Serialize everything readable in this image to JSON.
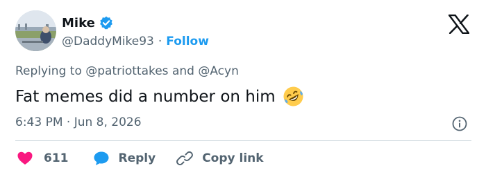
{
  "author": {
    "name": "Mike",
    "handle": "@DaddyMike93",
    "separator": "·",
    "follow_label": "Follow",
    "verified_color": "#1d9bf0"
  },
  "platform_logo": "x-logo-icon",
  "reply_context": "Replying to @patriottakes and @Acyn",
  "text": "Fat memes did a number on him",
  "emoji": "rolling-on-floor-laughing-emoji",
  "timestamp": "6:43 PM · Jun 8, 2026",
  "actions": {
    "likes_count": "611",
    "reply_label": "Reply",
    "copy_link_label": "Copy link"
  },
  "colors": {
    "text": "#0f1419",
    "secondary": "#536471",
    "accent": "#1d9bf0",
    "like": "#f91880",
    "divider": "#cfd9de"
  }
}
